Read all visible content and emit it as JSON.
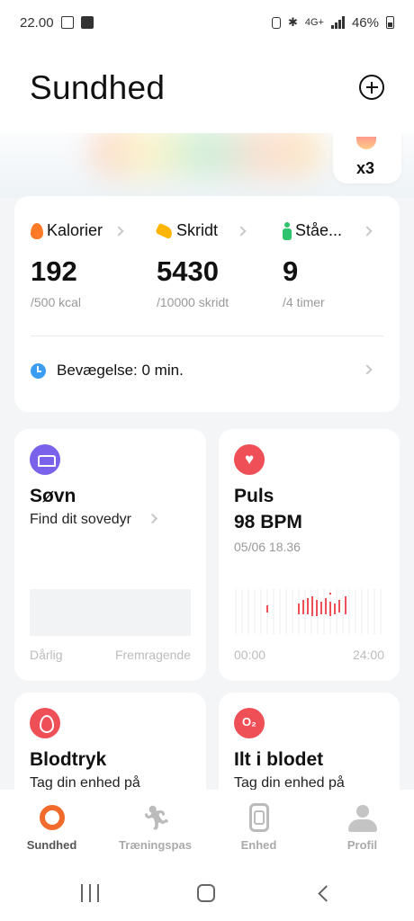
{
  "status_bar": {
    "time": "22.00",
    "network": "4G+",
    "battery": "46%"
  },
  "header": {
    "title": "Sundhed"
  },
  "banner": {
    "badge_count": "x3"
  },
  "activity": {
    "metrics": [
      {
        "label": "Kalorier",
        "value": "192",
        "goal": "/500 kcal",
        "icon": "flame-icon",
        "color": "#ff7a26"
      },
      {
        "label": "Skridt",
        "value": "5430",
        "goal": "/10000 skridt",
        "icon": "shoe-icon",
        "color": "#ffb400"
      },
      {
        "label": "Ståe...",
        "value": "9",
        "goal": "/4 timer",
        "icon": "person-icon",
        "color": "#2ec46d"
      }
    ],
    "movement": "Bevægelse: 0 min."
  },
  "sleep": {
    "title": "Søvn",
    "subtitle": "Find dit sovedyr",
    "axis_start": "Dårlig",
    "axis_end": "Fremragende"
  },
  "pulse": {
    "title": "Puls",
    "value": "98 BPM",
    "timestamp": "05/06 18.36",
    "axis_start": "00:00",
    "axis_end": "24:00",
    "bar_color": "#ef4f57"
  },
  "blood_pressure": {
    "title": "Blodtryk",
    "subtitle": "Tag din enhed på"
  },
  "blood_oxygen": {
    "title": "Ilt i blodet",
    "subtitle": "Tag din enhed på"
  },
  "bottom_nav": [
    {
      "label": "Sundhed",
      "icon": "ring-icon",
      "active": true
    },
    {
      "label": "Træningspas",
      "icon": "run-icon",
      "active": false
    },
    {
      "label": "Enhed",
      "icon": "watch-icon",
      "active": false
    },
    {
      "label": "Profil",
      "icon": "profile-icon",
      "active": false
    }
  ],
  "colors": {
    "accent": "#f26a2c",
    "sleep_icon": "#7b62ea",
    "health_red": "#ef4f57",
    "movement_blue": "#3a9df2"
  }
}
